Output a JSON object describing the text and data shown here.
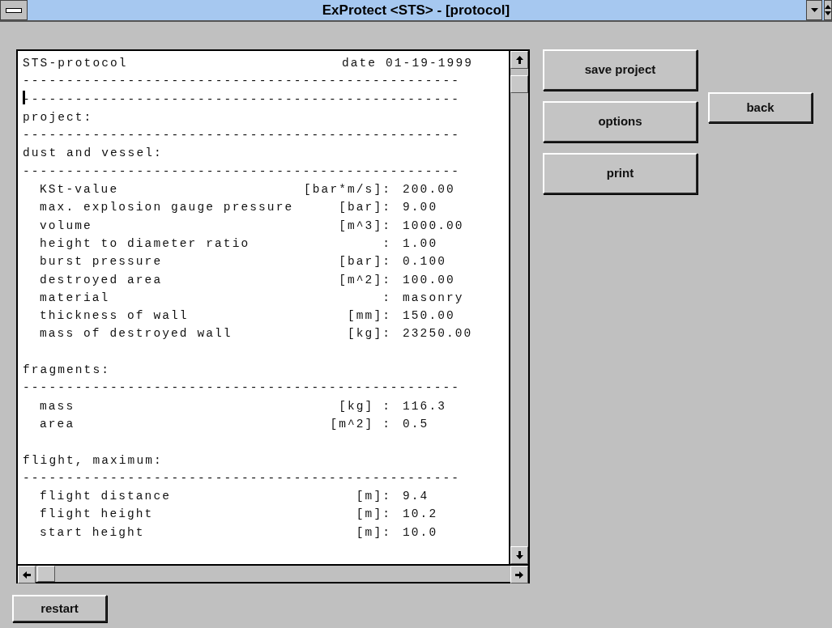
{
  "window": {
    "title": "ExProtect <STS> - [protocol]"
  },
  "protocol": {
    "lines": [
      {
        "kind": "header",
        "left": "STS-protocol",
        "right": "date 01-19-1999"
      },
      {
        "kind": "rule",
        "text": "--------------------------------------------------"
      },
      {
        "kind": "rule",
        "text": "--------------------------------------------------",
        "caret": true
      },
      {
        "kind": "heading",
        "text": "project:"
      },
      {
        "kind": "rule",
        "text": "--------------------------------------------------"
      },
      {
        "kind": "heading",
        "text": "dust and vessel:"
      },
      {
        "kind": "rule",
        "text": "--------------------------------------------------"
      },
      {
        "kind": "item",
        "label": "KSt-value",
        "unit": "[bar*m/s]:",
        "value": "200.00"
      },
      {
        "kind": "item",
        "label": "max. explosion gauge pressure",
        "unit": "[bar]:",
        "value": "9.00"
      },
      {
        "kind": "item",
        "label": "volume",
        "unit": "[m^3]:",
        "value": "1000.00"
      },
      {
        "kind": "item",
        "label": "height to diameter ratio",
        "unit": ":",
        "value": "1.00"
      },
      {
        "kind": "item",
        "label": "burst pressure",
        "unit": "[bar]:",
        "value": "0.100"
      },
      {
        "kind": "item",
        "label": "destroyed area",
        "unit": "[m^2]:",
        "value": "100.00"
      },
      {
        "kind": "item",
        "label": "material",
        "unit": ":",
        "value": "masonry"
      },
      {
        "kind": "item",
        "label": "thickness of wall",
        "unit": "[mm]:",
        "value": "150.00"
      },
      {
        "kind": "item",
        "label": "mass of destroyed wall",
        "unit": "[kg]:",
        "value": "23250.00"
      },
      {
        "kind": "blank"
      },
      {
        "kind": "heading",
        "text": "fragments:"
      },
      {
        "kind": "rule",
        "text": "--------------------------------------------------"
      },
      {
        "kind": "item",
        "label": "mass",
        "unit": "[kg] :",
        "value": "116.3"
      },
      {
        "kind": "item",
        "label": "area",
        "unit": "[m^2] :",
        "value": "0.5"
      },
      {
        "kind": "blank"
      },
      {
        "kind": "heading",
        "text": "flight, maximum:"
      },
      {
        "kind": "rule",
        "text": "--------------------------------------------------"
      },
      {
        "kind": "item",
        "label": "flight distance",
        "unit": "[m]:",
        "value": "9.4"
      },
      {
        "kind": "item",
        "label": "flight height",
        "unit": "[m]:",
        "value": "10.2"
      },
      {
        "kind": "item",
        "label": "start height",
        "unit": "[m]:",
        "value": "10.0"
      }
    ]
  },
  "side_buttons": [
    "save project",
    "options",
    "print"
  ],
  "back_button": "back",
  "restart_button": "restart"
}
